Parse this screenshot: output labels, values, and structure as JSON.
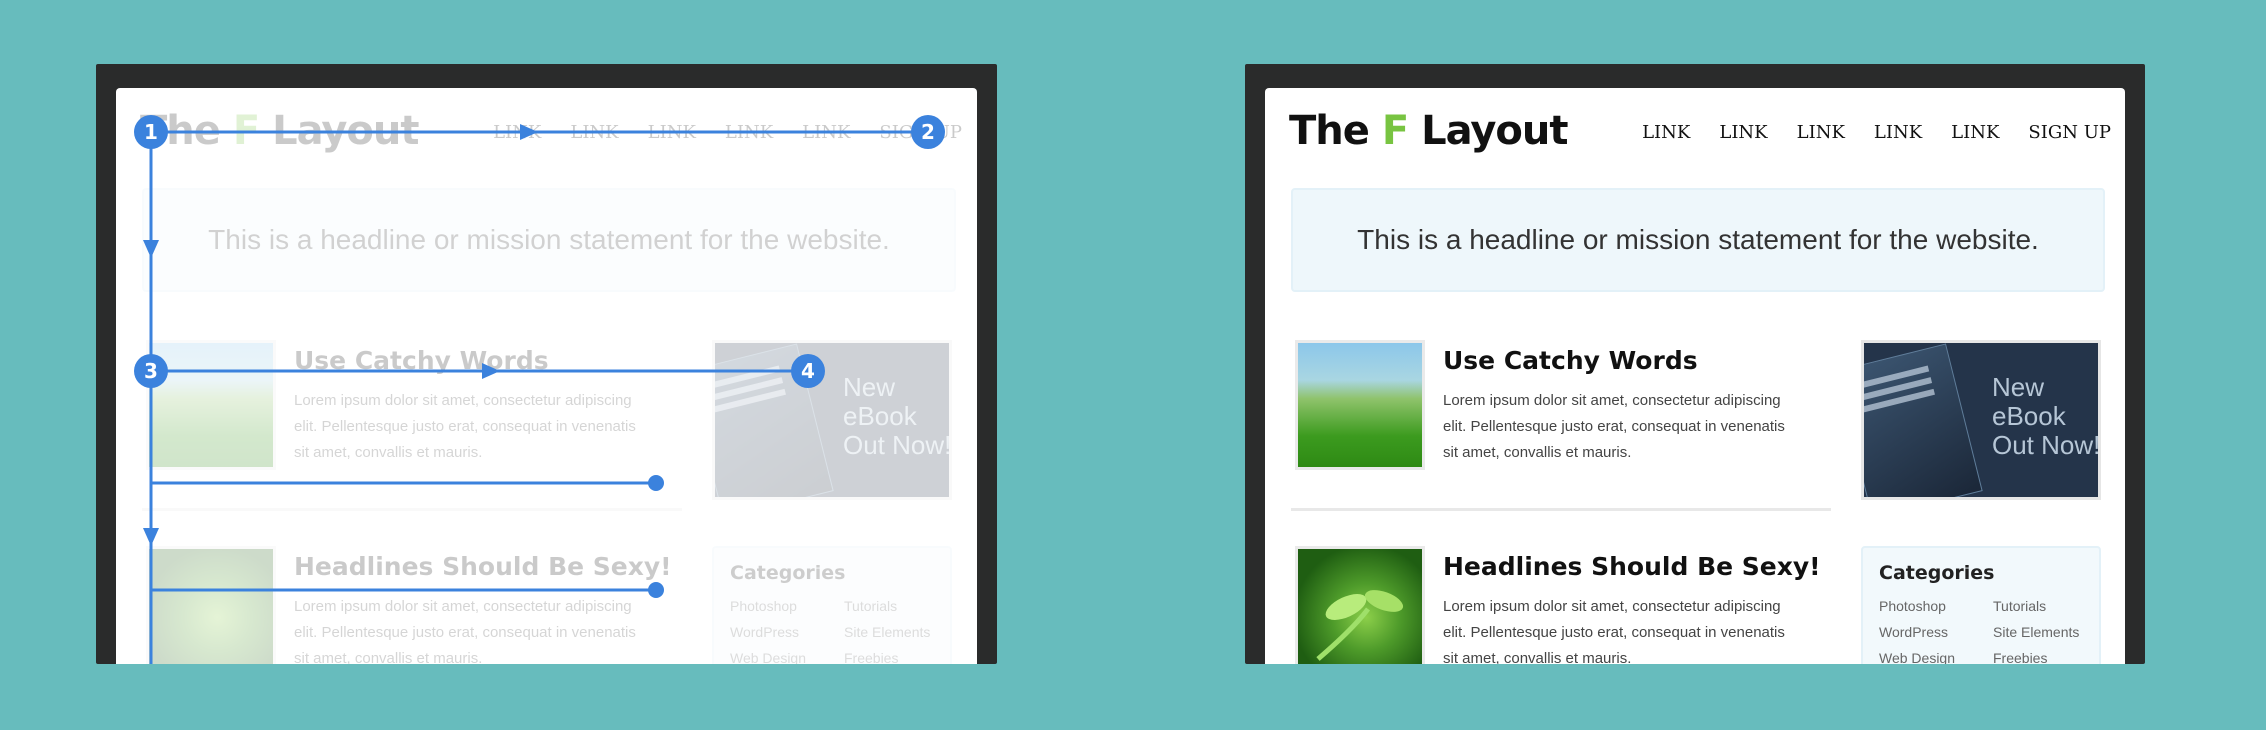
{
  "site": {
    "logo_pre": "The ",
    "logo_accent": "F",
    "logo_post": " Layout",
    "nav": [
      "LINK",
      "LINK",
      "LINK",
      "LINK",
      "LINK",
      "SIGN UP"
    ],
    "headline": "This is a headline or mission statement for the website.",
    "articles": [
      {
        "title": "Use Catchy Words",
        "lines": [
          "Lorem ipsum dolor sit amet, consectetur adipiscing",
          "elit. Pellentesque justo erat, consequat in venenatis",
          "sit amet, convallis et mauris."
        ]
      },
      {
        "title": "Headlines Should Be Sexy!",
        "lines": [
          "Lorem ipsum dolor sit amet, consectetur adipiscing",
          "elit. Pellentesque justo erat, consequat in venenatis",
          "sit amet, convallis et mauris."
        ]
      }
    ],
    "ebook_lines": [
      "New",
      "eBook",
      "Out Now!"
    ],
    "sidebar": {
      "title": "Categories",
      "categories": [
        "Photoshop",
        "Tutorials",
        "WordPress",
        "Site Elements",
        "Web Design",
        "Freebies"
      ]
    }
  },
  "markers": [
    "1",
    "2",
    "3",
    "4"
  ],
  "colors": {
    "background": "#67bcbd",
    "frame": "#2a2b2b",
    "logo_accent": "#78c441",
    "scan_path": "#3b82dd",
    "hero_fill": "#eef7fb",
    "ebook_fill": "#24344a"
  }
}
